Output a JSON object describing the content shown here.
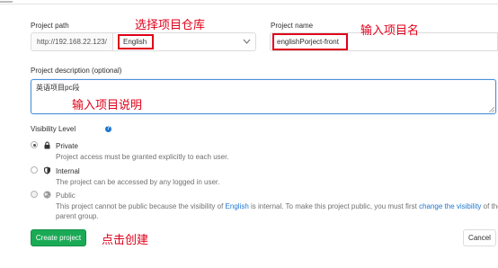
{
  "form": {
    "project_path": {
      "label": "Project path",
      "prefix": "http://192.168.22.123/",
      "namespace_value": "English"
    },
    "project_name": {
      "label": "Project name",
      "value": "englishPorject-front"
    },
    "description": {
      "label": "Project description (optional)",
      "value": "英语项目pc段"
    },
    "visibility": {
      "label": "Visibility Level",
      "help_icon": "question-circle-icon",
      "options": [
        {
          "title": "Private",
          "icon": "lock-icon",
          "checked": true,
          "description": "Project access must be granted explicitly to each user."
        },
        {
          "title": "Internal",
          "icon": "shield-icon",
          "checked": false,
          "description": "The project can be accessed by any logged in user."
        },
        {
          "title": "Public",
          "icon": "globe-icon",
          "checked": false,
          "description_part1": "This project cannot be public because the visibility of ",
          "group_link": "English",
          "description_part2": " is internal. To make this project public, you must first ",
          "change_link": "change the visibility",
          "description_part3": " of the",
          "description_line2": "parent group."
        }
      ]
    },
    "buttons": {
      "create": "Create project",
      "cancel": "Cancel"
    }
  },
  "annotations": {
    "select_repo": "选择项目仓库",
    "enter_name": "输入项目名",
    "enter_description": "输入项目说明",
    "click_create": "点击创建"
  },
  "colors": {
    "annotation_red": "#e1001a",
    "create_green": "#1aaa55",
    "link_blue": "#1f78d1",
    "focus_blue": "#4a90d9"
  }
}
